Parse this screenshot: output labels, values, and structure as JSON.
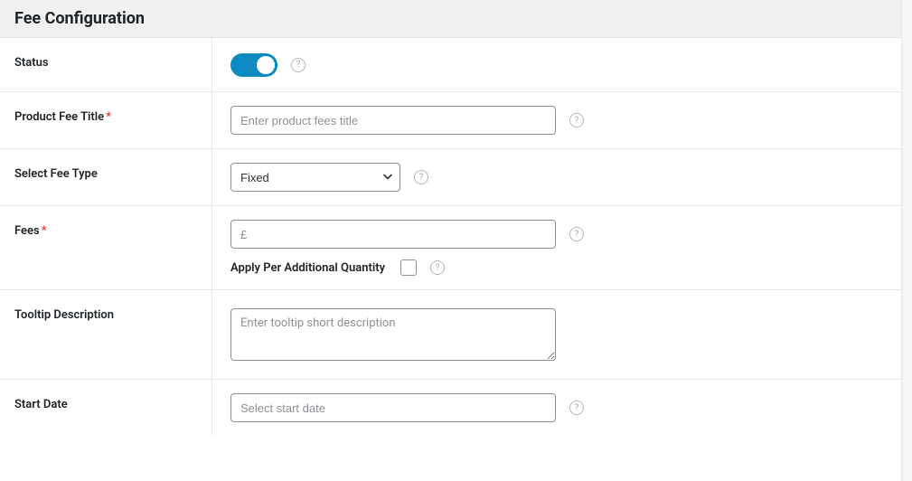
{
  "header": {
    "title": "Fee Configuration"
  },
  "fields": {
    "status": {
      "label": "Status",
      "value": true
    },
    "product_fee_title": {
      "label": "Product Fee Title",
      "required_mark": "*",
      "placeholder": "Enter product fees title",
      "value": ""
    },
    "select_fee_type": {
      "label": "Select Fee Type",
      "selected": "Fixed"
    },
    "fees": {
      "label": "Fees",
      "required_mark": "*",
      "placeholder": "£",
      "value": "",
      "apply_per_qty_label": "Apply Per Additional Quantity",
      "apply_per_qty_checked": false
    },
    "tooltip_description": {
      "label": "Tooltip Description",
      "placeholder": "Enter tooltip short description",
      "value": ""
    },
    "start_date": {
      "label": "Start Date",
      "placeholder": "Select start date",
      "value": ""
    }
  },
  "help_icon_glyph": "?"
}
